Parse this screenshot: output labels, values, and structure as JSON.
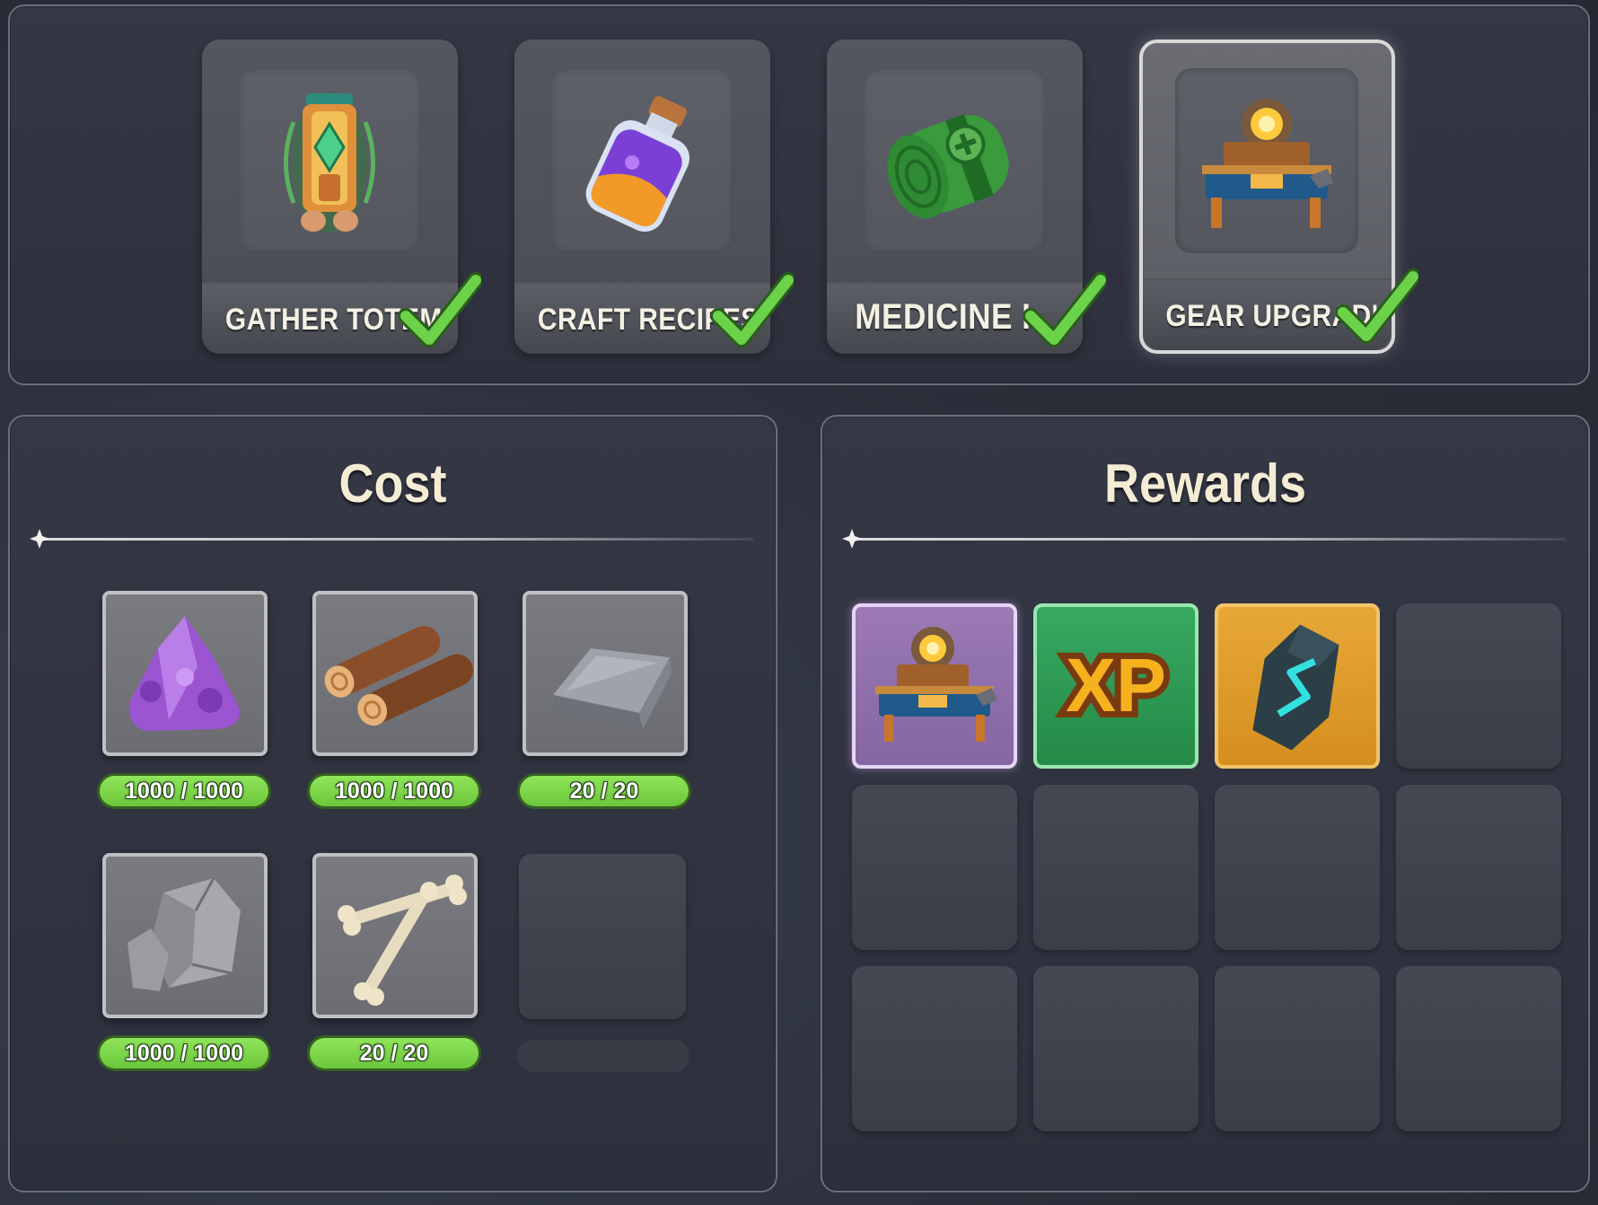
{
  "quests": [
    {
      "label": "GATHER TOTEM I",
      "completed": true,
      "selected": false,
      "icon": "totem-icon"
    },
    {
      "label": "CRAFT RECIPES I",
      "completed": true,
      "selected": false,
      "icon": "potion-icon"
    },
    {
      "label": "MEDICINE I",
      "completed": true,
      "selected": false,
      "icon": "bandage-roll-icon"
    },
    {
      "label": "GEAR UPGRADING",
      "completed": true,
      "selected": true,
      "icon": "upgrade-bench-icon"
    }
  ],
  "cost": {
    "title": "Cost",
    "items": [
      {
        "icon": "amethyst-crystal-icon",
        "amount": "1000 / 1000"
      },
      {
        "icon": "wood-logs-icon",
        "amount": "1000 / 1000"
      },
      {
        "icon": "iron-ingot-icon",
        "amount": "20 / 20"
      },
      {
        "icon": "stone-icon",
        "amount": "1000 / 1000"
      },
      {
        "icon": "bones-icon",
        "amount": "20 / 20"
      }
    ]
  },
  "rewards": {
    "title": "Rewards",
    "items": [
      {
        "icon": "upgrade-bench-icon",
        "rarity": "epic",
        "color": "#8f6eaf"
      },
      {
        "icon": "xp-icon",
        "rarity": "uncommon",
        "color": "#2a9a52",
        "text": "XP"
      },
      {
        "icon": "rune-stone-icon",
        "rarity": "legendary",
        "color": "#e09d2a"
      }
    ]
  },
  "colors": {
    "check_green": "#5fc43a",
    "pill_green": "#7ad648",
    "panel_bg": "#313440"
  }
}
